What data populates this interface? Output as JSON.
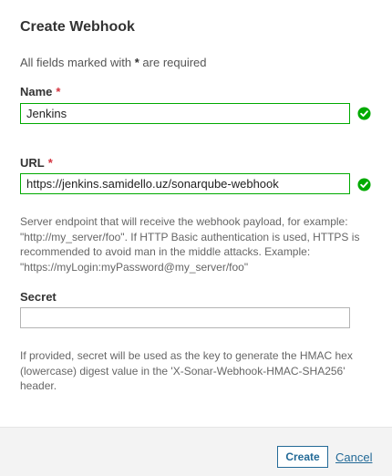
{
  "dialog": {
    "title": "Create Webhook",
    "required_note_prefix": "All fields marked with",
    "required_note_star": "*",
    "required_note_suffix": "are required"
  },
  "fields": {
    "name": {
      "label": "Name",
      "required_mark": "*",
      "value": "Jenkins",
      "valid": true
    },
    "url": {
      "label": "URL",
      "required_mark": "*",
      "value": "https://jenkins.samidello.uz/sonarqube-webhook",
      "valid": true,
      "help": "Server endpoint that will receive the webhook payload, for example: \"http://my_server/foo\". If HTTP Basic authentication is used, HTTPS is recommended to avoid man in the middle attacks. Example: \"https://myLogin:myPassword@my_server/foo\""
    },
    "secret": {
      "label": "Secret",
      "value": "",
      "help": "If provided, secret will be used as the key to generate the HMAC hex (lowercase) digest value in the 'X-Sonar-Webhook-HMAC-SHA256' header."
    }
  },
  "footer": {
    "create_label": "Create",
    "cancel_label": "Cancel"
  },
  "colors": {
    "valid_border": "#00aa00",
    "valid_icon": "#00aa00",
    "required_star": "#d4333f",
    "link": "#236a97"
  },
  "icons": {
    "valid": "check-circle-icon"
  }
}
